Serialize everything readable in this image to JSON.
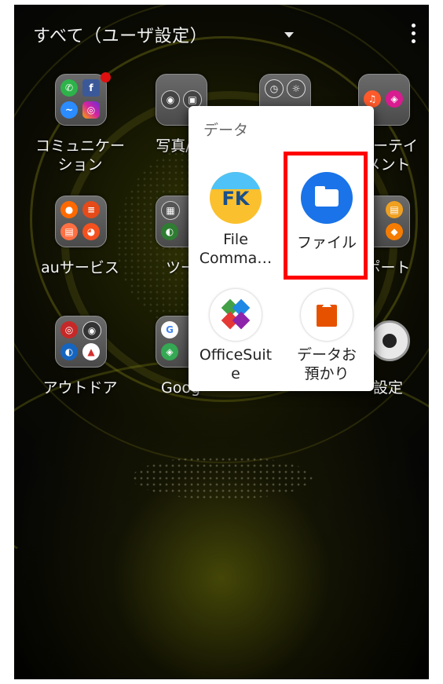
{
  "header": {
    "title": "すべて（ユーザ設定）"
  },
  "home_apps": [
    {
      "label": "コミュニケー\nション"
    },
    {
      "label": "写真/動"
    },
    {
      "label": ""
    },
    {
      "label": "ターテイ\nメント"
    },
    {
      "label": "auサービス"
    },
    {
      "label": "ツー"
    },
    {
      "label": ""
    },
    {
      "label": "ポート"
    },
    {
      "label": "アウトドア"
    },
    {
      "label": "Goog"
    },
    {
      "label": ""
    },
    {
      "label": "設定"
    }
  ],
  "folder_popup": {
    "title": "データ",
    "apps": [
      {
        "label": "File\nComma…",
        "icon_text": "FK"
      },
      {
        "label": "ファイル"
      },
      {
        "label": "OfficeSuit\ne"
      },
      {
        "label": "データお\n預かり"
      }
    ]
  },
  "colors": {
    "highlight": "#ff0000",
    "files_blue": "#1a73e8",
    "notification_dot": "#e01010"
  }
}
